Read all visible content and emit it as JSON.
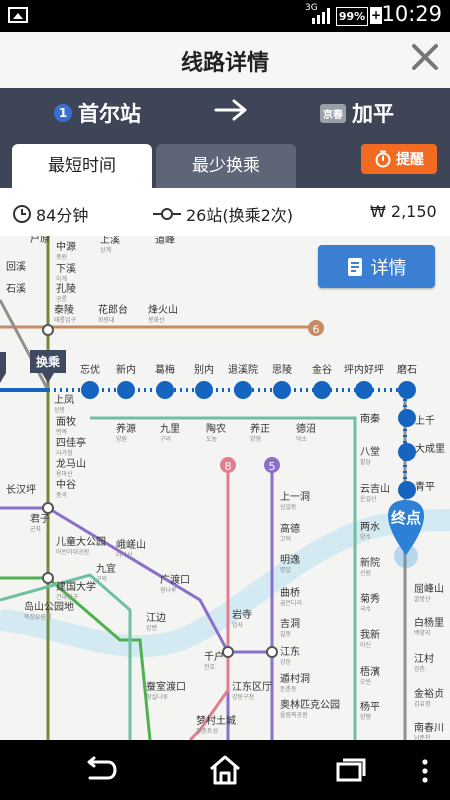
{
  "status_bar": {
    "network": "3G",
    "battery": "99%",
    "time": "10:29"
  },
  "header": {
    "title": "线路详情"
  },
  "route": {
    "from_line_number": "1",
    "from_station": "首尔站",
    "to_line_badge": "京春",
    "to_station": "加平"
  },
  "tabs": [
    {
      "label": "最短时间",
      "active": true
    },
    {
      "label": "最少换乘",
      "active": false
    }
  ],
  "remind_label": "提醒",
  "summary": {
    "duration": "84分钟",
    "stops": "26站(换乘2次)",
    "fare": "₩ 2,150"
  },
  "detail_button": "详情",
  "map": {
    "transfer_marker": "换乘",
    "end_marker": "终点",
    "line_labels": [
      "6",
      "8",
      "5"
    ],
    "route_stations": [
      "忘优",
      "新内",
      "葛梅",
      "别内",
      "退溪院",
      "思陵",
      "金谷",
      "坪内好坪",
      "磨石"
    ],
    "stations": [
      {
        "name": "户原",
        "sub": ""
      },
      {
        "name": "中源",
        "sub": "중원"
      },
      {
        "name": "下溪",
        "sub": "하계"
      },
      {
        "name": "孔陵",
        "sub": "공릉"
      },
      {
        "name": "泰陵",
        "sub": "태릉입구"
      },
      {
        "name": "花郎台",
        "sub": "화랑대"
      },
      {
        "name": "烽火山",
        "sub": "봉화산"
      },
      {
        "name": "上溪",
        "sub": "상계"
      },
      {
        "name": "道峰",
        "sub": ""
      },
      {
        "name": "回溪",
        "sub": ""
      },
      {
        "name": "石溪",
        "sub": ""
      },
      {
        "name": "上凤",
        "sub": "상봉"
      },
      {
        "name": "面牧",
        "sub": "면목"
      },
      {
        "name": "四佳亭",
        "sub": "사가정"
      },
      {
        "name": "龙马山",
        "sub": "용마산"
      },
      {
        "name": "中谷",
        "sub": "중곡"
      },
      {
        "name": "养源",
        "sub": "양원"
      },
      {
        "name": "九里",
        "sub": "구리"
      },
      {
        "name": "陶农",
        "sub": "도농"
      },
      {
        "name": "养正",
        "sub": "양정"
      },
      {
        "name": "德沼",
        "sub": "덕소"
      },
      {
        "name": "南秦",
        "sub": ""
      },
      {
        "name": "八堂",
        "sub": "팔당"
      },
      {
        "name": "云吉山",
        "sub": "운길산"
      },
      {
        "name": "两水",
        "sub": "양수"
      },
      {
        "name": "新院",
        "sub": "신원"
      },
      {
        "name": "菊秀",
        "sub": "국수"
      },
      {
        "name": "我新",
        "sub": "아신"
      },
      {
        "name": "梧濱",
        "sub": "오빈"
      },
      {
        "name": "杨平",
        "sub": "양평"
      },
      {
        "name": "大成里",
        "sub": ""
      },
      {
        "name": "青平",
        "sub": ""
      },
      {
        "name": "上千",
        "sub": ""
      },
      {
        "name": "屈峰山",
        "sub": "굴봉산"
      },
      {
        "name": "白杨里",
        "sub": "백양리"
      },
      {
        "name": "江村",
        "sub": "강촌"
      },
      {
        "name": "金裕贞",
        "sub": "김유정"
      },
      {
        "name": "南春川",
        "sub": "남춘천"
      },
      {
        "name": "长汉坪",
        "sub": ""
      },
      {
        "name": "君子",
        "sub": "군자"
      },
      {
        "name": "儿童大公园",
        "sub": "어린이대공원"
      },
      {
        "name": "建国大学",
        "sub": "건대입구"
      },
      {
        "name": "岛山公园地",
        "sub": "뚝섬유원지"
      },
      {
        "name": "九宜",
        "sub": "구의"
      },
      {
        "name": "峨嵯山",
        "sub": "아차산"
      },
      {
        "name": "广渡口",
        "sub": "광나루"
      },
      {
        "name": "江边",
        "sub": "강변"
      },
      {
        "name": "上一洞",
        "sub": "상일동"
      },
      {
        "name": "高德",
        "sub": "고덕"
      },
      {
        "name": "明逸",
        "sub": "명일"
      },
      {
        "name": "岩寺",
        "sub": "암사"
      },
      {
        "name": "曲桥",
        "sub": "굽은다리"
      },
      {
        "name": "吉洞",
        "sub": "길동"
      },
      {
        "name": "千户",
        "sub": "천호"
      },
      {
        "name": "江东",
        "sub": "강동"
      },
      {
        "name": "遁村洞",
        "sub": "둔촌동"
      },
      {
        "name": "奥林匹克公园",
        "sub": "올림픽공원"
      },
      {
        "name": "江东区厅",
        "sub": "강동구청"
      },
      {
        "name": "蚕室渡口",
        "sub": "잠실나루"
      },
      {
        "name": "梦村土城",
        "sub": "몽촌토성"
      }
    ]
  },
  "colors": {
    "route_blue": "#1565c0",
    "line6": "#c78a62",
    "line8": "#e07d8e",
    "line5": "#8a70c8",
    "central": "#6fbfa3",
    "gyeongui": "#8f8f8f",
    "remind": "#f26b21",
    "detail_button": "#3b7fd2",
    "route_bar": "#3d4556"
  }
}
